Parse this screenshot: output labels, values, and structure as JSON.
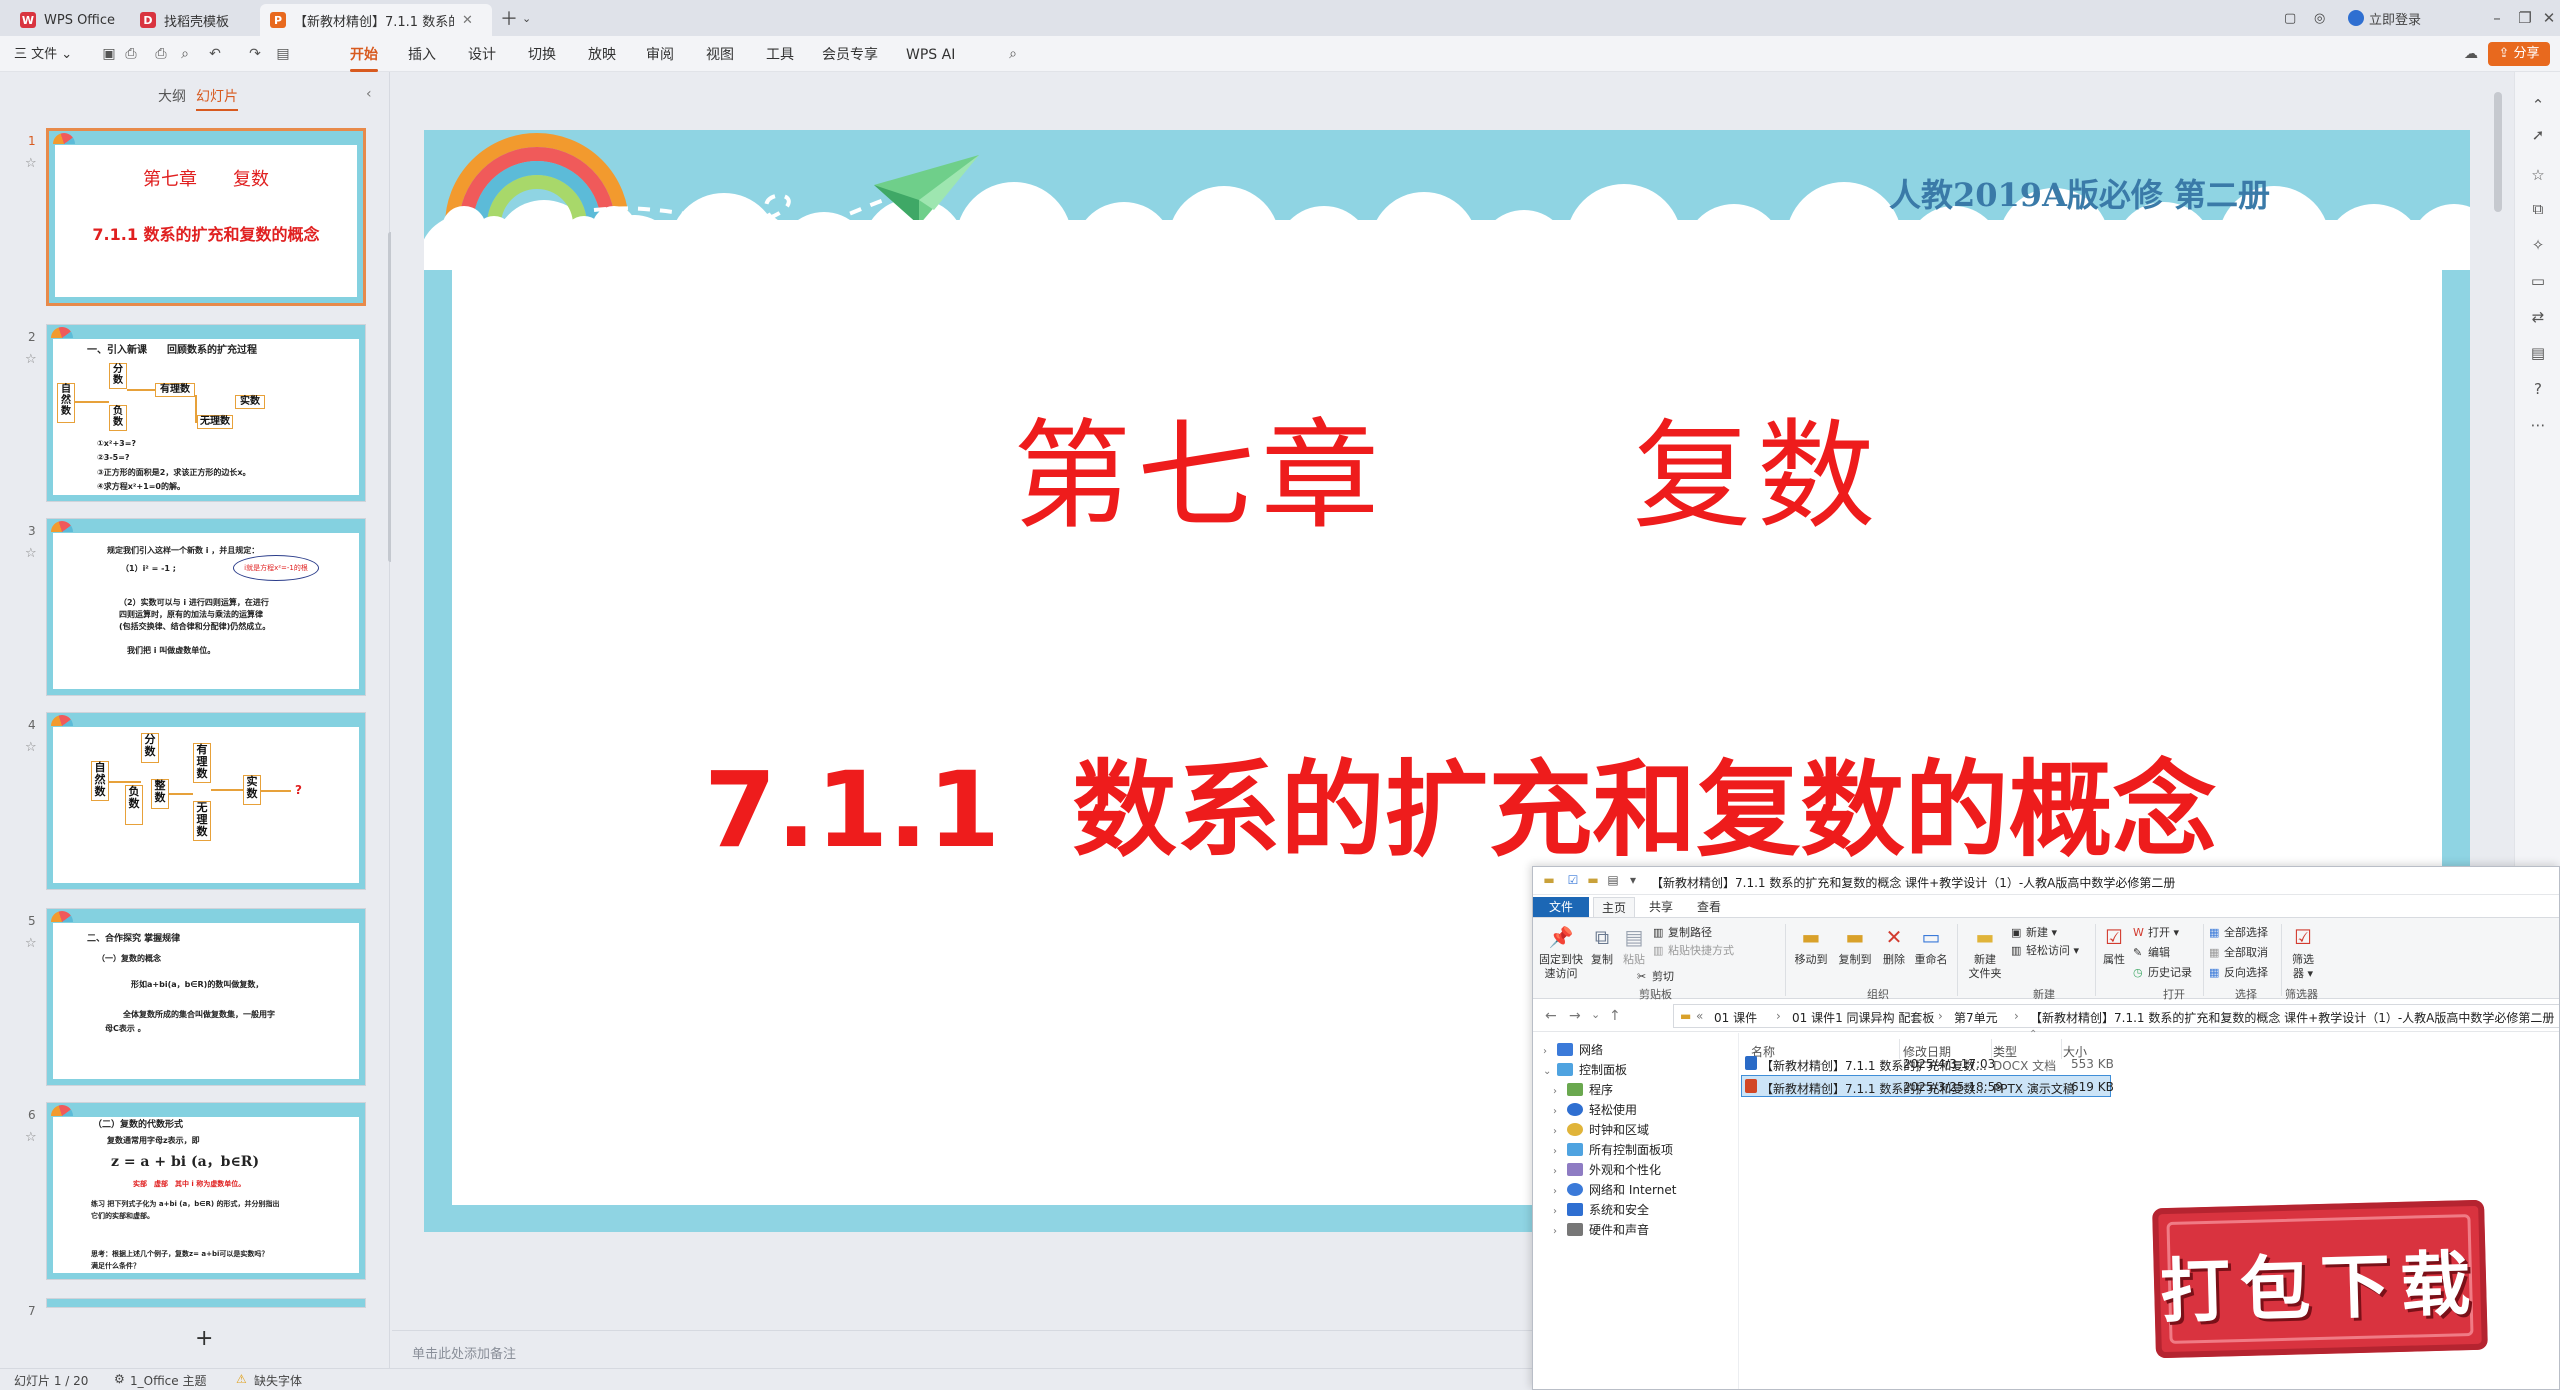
{
  "titlebar": {
    "tabs": [
      {
        "label": "WPS Office",
        "icon": "wps-logo-icon",
        "color": "#d9343f"
      },
      {
        "label": "找稻壳模板",
        "icon": "docer-icon",
        "color": "#d9343f"
      },
      {
        "label": "【新教材精创】7.1.1 数系的扩",
        "icon": "ppt-icon",
        "color": "#e8691e"
      }
    ],
    "login": "立即登录"
  },
  "menubar": {
    "file": "三 文件 ⌄",
    "items": [
      "开始",
      "插入",
      "设计",
      "切换",
      "放映",
      "审阅",
      "视图",
      "工具",
      "会员专享",
      "WPS AI"
    ],
    "active": "开始",
    "share": "分享"
  },
  "leftpanel": {
    "tabs": [
      "大纲",
      "幻灯片"
    ],
    "active_tab": "幻灯片",
    "slides": [
      {
        "num": "1",
        "title": "第七章　　复数",
        "subtitle": "7.1.1  数系的扩充和复数的概念"
      },
      {
        "num": "2",
        "heading": "一、引入新课　　回顾数系的扩充过程",
        "lines": [
          "①x²+3=?",
          "②3-5=?",
          "③正方形的面积是2，求该正方形的边长x。",
          "④求方程x²+1=0的解。"
        ],
        "boxes": [
          "自然数",
          "分数",
          "负数",
          "有理数",
          "无理数",
          "实数"
        ]
      },
      {
        "num": "3",
        "lines": [
          "规定我们引入这样一个新数 i ，并且规定：",
          "（1）i² = -1 ;",
          "（2）实数可以与 i 进行四则运算，在进行",
          "四则运算时，原有的加法与乘法的运算律",
          "(包括交换律、结合律和分配律)仍然成立。",
          "我们把 i 叫做虚数单位。"
        ],
        "bubble": "i就是方程x²=-1的根"
      },
      {
        "num": "4",
        "boxes": [
          "自然数",
          "分数",
          "负数",
          "整数",
          "有理数",
          "无理数",
          "实数",
          "?"
        ]
      },
      {
        "num": "5",
        "lines": [
          "二、合作探究 掌握规律",
          "（一）复数的概念",
          "形如a+bi(a，b∈R)的数叫做复数，",
          "全体复数所成的集合叫做复数集，一般用字",
          "母C表示 。"
        ]
      },
      {
        "num": "6",
        "lines": [
          "（二）复数的代数形式",
          "复数通常用字母z表示，即",
          "z = a + bi (a，b∈R)",
          "实部　虚部　其中 i 称为虚数单位。",
          "练习 把下列式子化为 a+bi (a，b∈R) 的形式，并分别指出",
          "它们的实部和虚部。",
          "思考：根据上述几个例子，复数z= a+bi可以是实数吗？",
          "满足什么条件？"
        ]
      },
      {
        "num": "7"
      }
    ]
  },
  "slide": {
    "top_right": "人教2019A版必修 第二册",
    "title": "第七章　　复数",
    "subtitle": "7.1.1  数系的扩充和复数的概念"
  },
  "notes_placeholder": "单击此处添加备注",
  "statusbar": {
    "slide": "幻灯片 1 / 20",
    "theme": "1_Office 主题",
    "font": "缺失字体"
  },
  "explorer": {
    "title": "【新教材精创】7.1.1 数系的扩充和复数的概念 课件+教学设计（1）-人教A版高中数学必修第二册",
    "tabs": [
      "文件",
      "主页",
      "共享",
      "查看"
    ],
    "ribbon": {
      "pin": "固定到快\n速访问",
      "copy": "复制",
      "paste": "粘贴",
      "copy_path": "复制路径",
      "paste_shortcut": "粘贴快捷方式",
      "cut": "剪切",
      "move_to": "移动到",
      "copy_to": "复制到",
      "delete": "删除",
      "rename": "重命名",
      "new_folder": "新建\n文件夹",
      "new_item": "新建 ▾",
      "easy_access": "轻松访问 ▾",
      "properties": "属性",
      "open": "打开 ▾",
      "edit": "编辑",
      "history": "历史记录",
      "select_all": "全部选择",
      "select_none": "全部取消",
      "invert": "反向选择",
      "filter": "筛选\n器 ▾",
      "groups": [
        "剪贴板",
        "组织",
        "新建",
        "打开",
        "选择",
        "筛选器"
      ]
    },
    "address": [
      "«",
      "01 课件",
      "›",
      "01 课件1 同课异构 配套板",
      "›",
      "第7单元",
      "›",
      "【新教材精创】7.1.1 数系的扩充和复数的概念 课件+教学设计（1）-人教A版高中数学必修第二册"
    ],
    "tree": [
      "网络",
      "控制面板",
      "程序",
      "轻松使用",
      "时钟和区域",
      "所有控制面板项",
      "外观和个性化",
      "网络和 Internet",
      "系统和安全",
      "硬件和声音"
    ],
    "columns": [
      "名称",
      "修改日期",
      "类型",
      "大小"
    ],
    "files": [
      {
        "name": "【新教材精创】7.1.1 数系的扩充和复数...",
        "date": "2025/4/3 17:03",
        "type": "DOCX 文档",
        "size": "553 KB",
        "color": "#2b6bc7"
      },
      {
        "name": "【新教材精创】7.1.1 数系的扩充和复数...",
        "date": "2025/3/25 18:59",
        "type": "PPTX 演示文稿",
        "size": "619 KB",
        "color": "#d24726"
      }
    ]
  },
  "badge": "打包下载"
}
